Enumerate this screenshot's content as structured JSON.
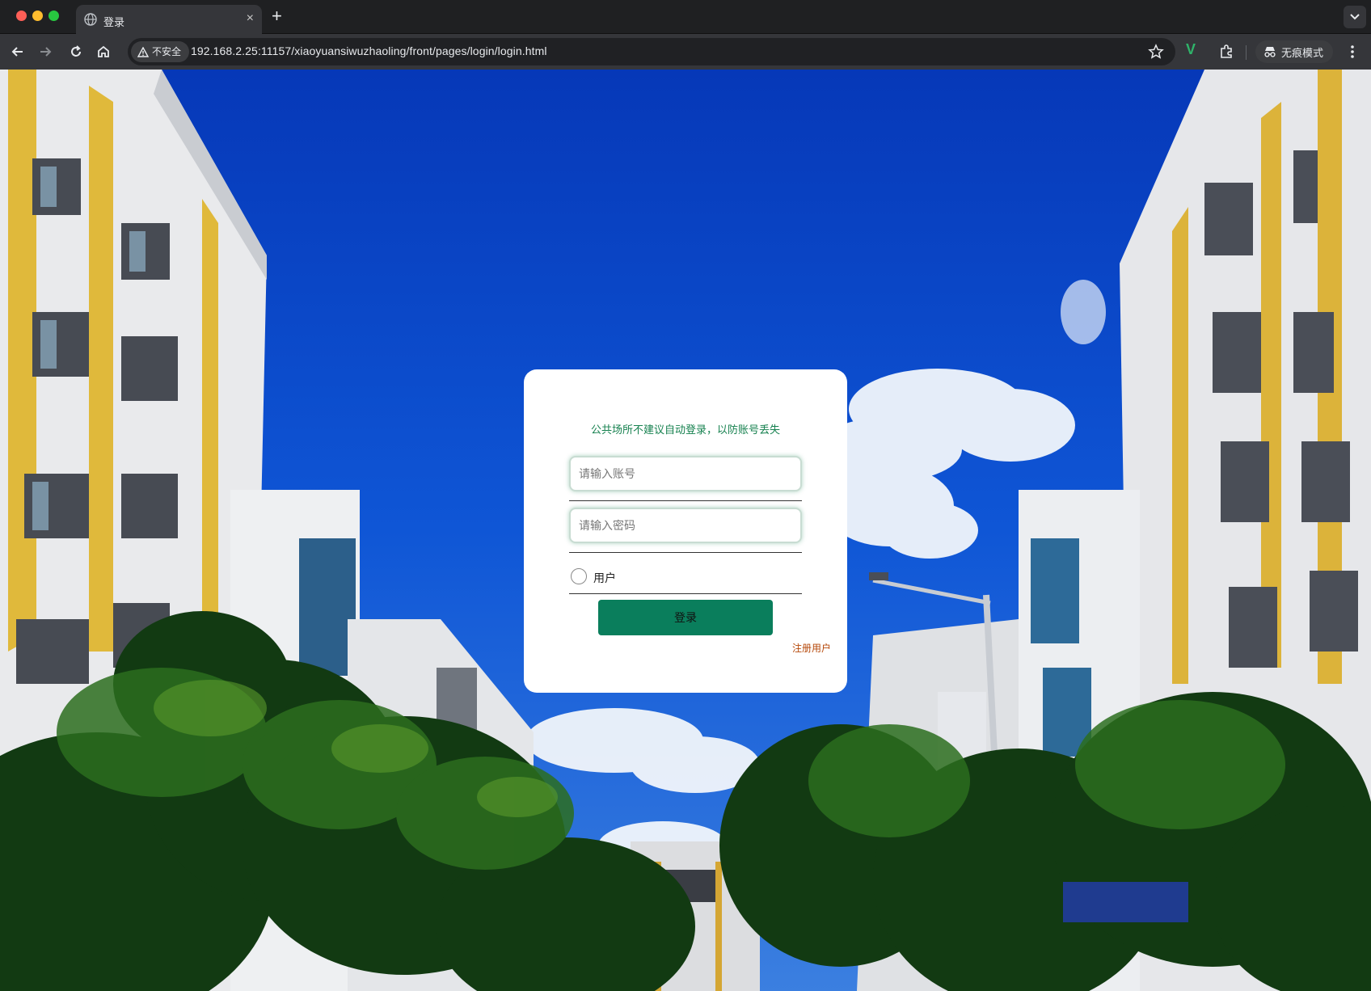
{
  "browser": {
    "tab_title": "登录",
    "tab_close": "×",
    "new_tab": "+",
    "security_label": "不安全",
    "url": "192.168.2.25:11157/xiaoyuansiwuzhaoling/front/pages/login/login.html",
    "extension_label": "V",
    "incognito_label": "无痕模式"
  },
  "login": {
    "notice": "公共场所不建议自动登录，以防账号丢失",
    "account_placeholder": "请输入账号",
    "password_placeholder": "请输入密码",
    "role_option": "用户",
    "submit_label": "登录",
    "register_label": "注册用户"
  },
  "colors": {
    "accent": "#0a7e5c",
    "notice_text": "#16814f",
    "register_link": "#b54708",
    "sky": "#0d52d8"
  }
}
